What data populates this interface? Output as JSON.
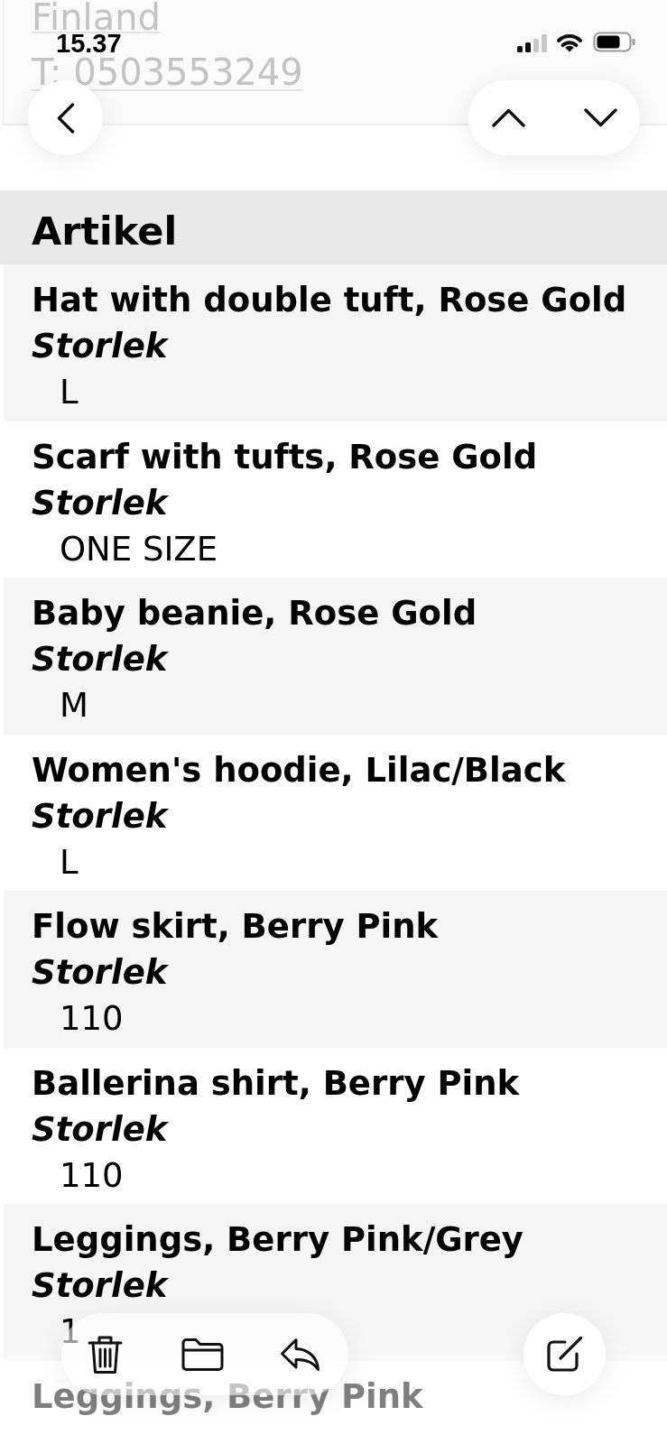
{
  "status_bar": {
    "time": "15.37"
  },
  "address": {
    "country": "Finland",
    "phone": "T: 0503553249"
  },
  "items_section": {
    "heading": "Artikel",
    "items": [
      {
        "name": "Hat with double tuft, Rose Gold",
        "attribute": "Storlek",
        "value": "L"
      },
      {
        "name": "Scarf with tufts, Rose Gold",
        "attribute": "Storlek",
        "value": "ONE SIZE"
      },
      {
        "name": "Baby beanie, Rose Gold",
        "attribute": "Storlek",
        "value": "M"
      },
      {
        "name": "Women's hoodie, Lilac/Black",
        "attribute": "Storlek",
        "value": "L"
      },
      {
        "name": "Flow skirt, Berry Pink",
        "attribute": "Storlek",
        "value": "110"
      },
      {
        "name": "Ballerina shirt, Berry Pink",
        "attribute": "Storlek",
        "value": "110"
      },
      {
        "name": "Leggings, Berry Pink/Grey",
        "attribute": "Storlek",
        "value": "1"
      },
      {
        "name": "Leggings, Berry Pink"
      }
    ]
  }
}
